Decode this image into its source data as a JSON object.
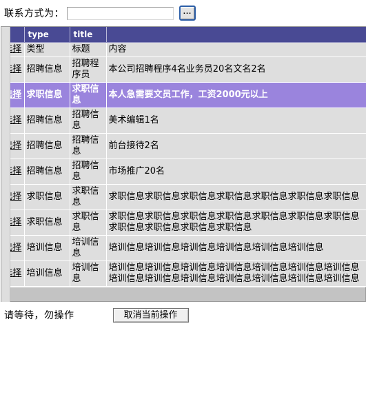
{
  "form": {
    "contact_label": "联系方式为：",
    "contact_value": "",
    "contact_placeholder": "",
    "browse_label": "..."
  },
  "grid": {
    "headers": [
      "",
      "type",
      "title",
      ""
    ],
    "columns": {
      "select": "选择",
      "type": "类型",
      "title": "标题",
      "content": "内容"
    },
    "select_label": "选择",
    "rows": [
      {
        "select": "选择",
        "type": "类型",
        "title": "标题",
        "content": "内容",
        "selected": false
      },
      {
        "select": "选择",
        "type": "招聘信息",
        "title": "招聘程序员",
        "content": "本公司招聘程序4名业务员20名文名2名",
        "selected": false
      },
      {
        "select": "选择",
        "type": "求职信息",
        "title": "求职信息",
        "content": "本人急需要文员工作，工资2000元以上",
        "selected": true
      },
      {
        "select": "选择",
        "type": "招聘信息",
        "title": "招聘信息",
        "content": "美术编辑1名",
        "selected": false
      },
      {
        "select": "选择",
        "type": "招聘信息",
        "title": "招聘信息",
        "content": "前台接待2名",
        "selected": false
      },
      {
        "select": "选择",
        "type": "招聘信息",
        "title": "招聘信息",
        "content": "市场推广20名",
        "selected": false
      },
      {
        "select": "选择",
        "type": "求职信息",
        "title": "求职信息",
        "content": "求职信息求职信息求职信息求职信息求职信息求职信息求职信息",
        "selected": false
      },
      {
        "select": "选择",
        "type": "求职信息",
        "title": "求职信息",
        "content": "求职信息求职信息求职信息求职信息求职信息求职信息求职信息求职信息求职信息求职信息求职信息",
        "selected": false
      },
      {
        "select": "选择",
        "type": "培训信息",
        "title": "培训信息",
        "content": "培训信息培训信息培训信息培训信息培训信息培训信息",
        "selected": false
      },
      {
        "select": "选择",
        "type": "培训信息",
        "title": "培训信息",
        "content": "培训信息培训信息培训信息培训信息培训信息培训信息培训信息培训信息培训信息培训信息培训信息培训信息培训信息培训信息",
        "selected": false
      }
    ]
  },
  "footer": {
    "status": "请等待，勿操作",
    "cancel_label": "取消当前操作"
  },
  "colors": {
    "header_bg": "#494a94",
    "selected_row_bg": "#9a84dd",
    "row_bg": "#dedede",
    "scrollbar_bg": "#c3c3c3",
    "focus_border": "#2d5fa8"
  }
}
